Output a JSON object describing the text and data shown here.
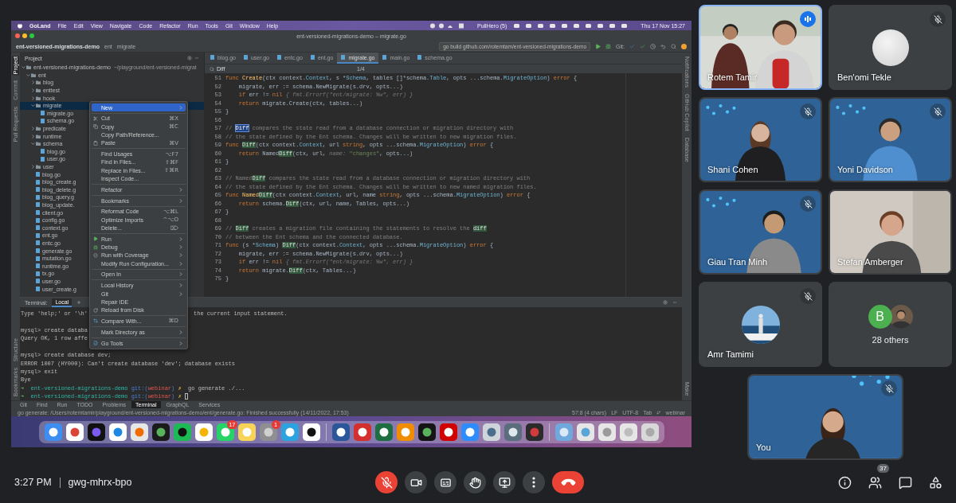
{
  "shared_screen": {
    "menu_bar": {
      "app": "GoLand",
      "items": [
        "File",
        "Edit",
        "View",
        "Navigate",
        "Code",
        "Refactor",
        "Run",
        "Tools",
        "Git",
        "Window",
        "Help"
      ],
      "status_item": "PullHero (5)",
      "clock": "Thu 17 Nov 15:27"
    },
    "window_title": "ent-versioned-migrations-demo – migrate.go",
    "breadcrumbs": [
      "ent-versioned-migrations-demo",
      "ent",
      "migrate"
    ],
    "run_configuration": "go build github.com/rotemtam/ent-versioned-migrations-demo",
    "vcs_label": "Git:",
    "left_tool_windows": [
      {
        "label": "Project",
        "selected": true
      },
      {
        "label": "Commit",
        "selected": false
      },
      {
        "label": "Pull Requests",
        "selected": false
      }
    ],
    "left_bottom_tool_windows": [
      {
        "label": "Structure",
        "selected": false
      },
      {
        "label": "Bookmarks",
        "selected": false
      }
    ],
    "right_tool_windows": [
      "Notifications",
      "GitHub Copilot",
      "Database"
    ],
    "right_bottom_tool_window": "Make",
    "project": {
      "title": "Project",
      "tree": [
        {
          "label": "ent-versioned-migrations-demo",
          "path": "~/playground/ent-versioned-migrat",
          "kind": "folder",
          "expanded": true,
          "selected": false,
          "children": [
            {
              "label": "ent",
              "kind": "folder",
              "expanded": true,
              "selected": false,
              "children": [
                {
                  "label": "blog",
                  "kind": "folder",
                  "expanded": false,
                  "selected": false
                },
                {
                  "label": "enttest",
                  "kind": "folder",
                  "expanded": false,
                  "selected": false
                },
                {
                  "label": "hook",
                  "kind": "folder",
                  "expanded": false,
                  "selected": false
                },
                {
                  "label": "migrate",
                  "kind": "folder",
                  "expanded": true,
                  "selected": true,
                  "children": [
                    {
                      "label": "migrate.go",
                      "kind": "file",
                      "selected": false
                    },
                    {
                      "label": "schema.go",
                      "kind": "file",
                      "selected": false
                    }
                  ]
                },
                {
                  "label": "predicate",
                  "kind": "folder",
                  "expanded": false,
                  "selected": false
                },
                {
                  "label": "runtime",
                  "kind": "folder",
                  "expanded": false,
                  "selected": false
                },
                {
                  "label": "schema",
                  "kind": "folder",
                  "expanded": true,
                  "selected": false,
                  "children": [
                    {
                      "label": "blog.go",
                      "kind": "file",
                      "selected": false
                    },
                    {
                      "label": "user.go",
                      "kind": "file",
                      "selected": false
                    }
                  ]
                },
                {
                  "label": "user",
                  "kind": "folder",
                  "expanded": false,
                  "selected": false
                },
                {
                  "label": "blog.go",
                  "kind": "file",
                  "selected": false
                },
                {
                  "label": "blog_create.g",
                  "kind": "file",
                  "selected": false
                },
                {
                  "label": "blog_delete.g",
                  "kind": "file",
                  "selected": false
                },
                {
                  "label": "blog_query.g",
                  "kind": "file",
                  "selected": false
                },
                {
                  "label": "blog_update.",
                  "kind": "file",
                  "selected": false
                },
                {
                  "label": "client.go",
                  "kind": "file",
                  "selected": false
                },
                {
                  "label": "config.go",
                  "kind": "file",
                  "selected": false
                },
                {
                  "label": "context.go",
                  "kind": "file",
                  "selected": false
                },
                {
                  "label": "ent.go",
                  "kind": "file",
                  "selected": false
                },
                {
                  "label": "entc.go",
                  "kind": "file",
                  "selected": false
                },
                {
                  "label": "generate.go",
                  "kind": "file",
                  "selected": false
                },
                {
                  "label": "mutation.go",
                  "kind": "file",
                  "selected": false
                },
                {
                  "label": "runtime.go",
                  "kind": "file",
                  "selected": false
                },
                {
                  "label": "tx.go",
                  "kind": "file",
                  "selected": false
                },
                {
                  "label": "user.go",
                  "kind": "file",
                  "selected": false
                },
                {
                  "label": "user_create.g",
                  "kind": "file",
                  "selected": false
                }
              ]
            }
          ]
        }
      ]
    },
    "editor": {
      "tabs": [
        {
          "label": "blog.go",
          "selected": false
        },
        {
          "label": "user.go",
          "selected": false
        },
        {
          "label": "entc.go",
          "selected": false
        },
        {
          "label": "ent.go",
          "selected": false
        },
        {
          "label": "migrate.go",
          "selected": true
        },
        {
          "label": "main.go",
          "selected": false
        },
        {
          "label": "schema.go",
          "selected": false
        }
      ],
      "find": {
        "value": "Diff",
        "count": "1/4"
      },
      "lines": [
        {
          "number": "51",
          "segments": [
            {
              "kind": "keyword",
              "text": "func "
            },
            {
              "kind": "function",
              "text": "Create"
            },
            {
              "kind": "plain",
              "text": "(ctx context."
            },
            {
              "kind": "type",
              "text": "Context"
            },
            {
              "kind": "plain",
              "text": ", s *"
            },
            {
              "kind": "type",
              "text": "Schema"
            },
            {
              "kind": "plain",
              "text": ", tables []*schema."
            },
            {
              "kind": "type",
              "text": "Table"
            },
            {
              "kind": "plain",
              "text": ", opts ...schema."
            },
            {
              "kind": "type",
              "text": "MigrateOption"
            },
            {
              "kind": "plain",
              "text": ") "
            },
            {
              "kind": "keyword",
              "text": "error"
            },
            {
              "kind": "plain",
              "text": " {"
            }
          ]
        },
        {
          "number": "52",
          "segments": [
            {
              "kind": "plain",
              "text": "    migrate, err := schema.NewMigrate(s.drv, opts...)"
            }
          ]
        },
        {
          "number": "53",
          "segments": [
            {
              "kind": "keyword",
              "text": "    if"
            },
            {
              "kind": "plain",
              "text": " err != "
            },
            {
              "kind": "keyword",
              "text": "nil"
            },
            {
              "kind": "hint",
              "text": " { fmt.Errorf(\"ent/migrate: %w\", err) }"
            }
          ]
        },
        {
          "number": "54",
          "segments": [
            {
              "kind": "keyword",
              "text": "    return"
            },
            {
              "kind": "plain",
              "text": " migrate.Create(ctx, tables...)"
            }
          ]
        },
        {
          "number": "55",
          "segments": [
            {
              "kind": "plain",
              "text": "}"
            }
          ]
        },
        {
          "number": "56"
        },
        {
          "number": "57",
          "segments": [
            {
              "kind": "comment",
              "text": "// "
            },
            {
              "kind": "current",
              "text": "Diff"
            },
            {
              "kind": "comment",
              "text": " compares the state read from a database connection or migration directory with"
            }
          ]
        },
        {
          "number": "58",
          "segments": [
            {
              "kind": "comment",
              "text": "// the state defined by the Ent schema. Changes will be written to new migration files."
            }
          ]
        },
        {
          "number": "59",
          "segments": [
            {
              "kind": "keyword",
              "text": "func "
            },
            {
              "kind": "match",
              "text": "Diff"
            },
            {
              "kind": "plain",
              "text": "(ctx context."
            },
            {
              "kind": "type",
              "text": "Context"
            },
            {
              "kind": "plain",
              "text": ", url "
            },
            {
              "kind": "keyword",
              "text": "string"
            },
            {
              "kind": "plain",
              "text": ", opts ...schema."
            },
            {
              "kind": "type",
              "text": "MigrateOption"
            },
            {
              "kind": "plain",
              "text": ") "
            },
            {
              "kind": "keyword",
              "text": "error"
            },
            {
              "kind": "plain",
              "text": " {"
            }
          ]
        },
        {
          "number": "60",
          "segments": [
            {
              "kind": "keyword",
              "text": "    return"
            },
            {
              "kind": "plain",
              "text": " Named"
            },
            {
              "kind": "match",
              "text": "Diff"
            },
            {
              "kind": "plain",
              "text": "(ctx, url, "
            },
            {
              "kind": "hint",
              "text": "name: "
            },
            {
              "kind": "string",
              "text": "\"changes\""
            },
            {
              "kind": "plain",
              "text": ", opts...)"
            }
          ]
        },
        {
          "number": "61",
          "segments": [
            {
              "kind": "plain",
              "text": "}"
            }
          ]
        },
        {
          "number": "62"
        },
        {
          "number": "63",
          "segments": [
            {
              "kind": "comment",
              "text": "// Named"
            },
            {
              "kind": "match",
              "text": "Diff"
            },
            {
              "kind": "comment",
              "text": " compares the state read from a database connection or migration directory with"
            }
          ]
        },
        {
          "number": "64",
          "segments": [
            {
              "kind": "comment",
              "text": "// the state defined by the Ent schema. Changes will be written to new named migration files."
            }
          ]
        },
        {
          "number": "65",
          "segments": [
            {
              "kind": "keyword",
              "text": "func "
            },
            {
              "kind": "function",
              "text": "Named"
            },
            {
              "kind": "match",
              "text": "Diff"
            },
            {
              "kind": "plain",
              "text": "(ctx context."
            },
            {
              "kind": "type",
              "text": "Context"
            },
            {
              "kind": "plain",
              "text": ", url, name "
            },
            {
              "kind": "keyword",
              "text": "string"
            },
            {
              "kind": "plain",
              "text": ", opts ...schema."
            },
            {
              "kind": "type",
              "text": "MigrateOption"
            },
            {
              "kind": "plain",
              "text": ") "
            },
            {
              "kind": "keyword",
              "text": "error"
            },
            {
              "kind": "plain",
              "text": " {"
            }
          ]
        },
        {
          "number": "66",
          "segments": [
            {
              "kind": "keyword",
              "text": "    return"
            },
            {
              "kind": "plain",
              "text": " schema."
            },
            {
              "kind": "match",
              "text": "Diff"
            },
            {
              "kind": "plain",
              "text": "(ctx, url, name, Tables, opts...)"
            }
          ]
        },
        {
          "number": "67",
          "segments": [
            {
              "kind": "plain",
              "text": "}"
            }
          ]
        },
        {
          "number": "68"
        },
        {
          "number": "69",
          "segments": [
            {
              "kind": "comment",
              "text": "// "
            },
            {
              "kind": "match",
              "text": "Diff"
            },
            {
              "kind": "comment",
              "text": " creates a migration file containing the statements to resolve the "
            },
            {
              "kind": "match",
              "text": "diff"
            }
          ]
        },
        {
          "number": "70",
          "segments": [
            {
              "kind": "comment",
              "text": "// between the Ent schema and the connected database."
            }
          ]
        },
        {
          "number": "71",
          "segments": [
            {
              "kind": "keyword",
              "text": "func "
            },
            {
              "kind": "plain",
              "text": "(s *"
            },
            {
              "kind": "type",
              "text": "Schema"
            },
            {
              "kind": "plain",
              "text": ") "
            },
            {
              "kind": "match",
              "text": "Diff"
            },
            {
              "kind": "plain",
              "text": "(ctx context."
            },
            {
              "kind": "type",
              "text": "Context"
            },
            {
              "kind": "plain",
              "text": ", opts ...schema."
            },
            {
              "kind": "type",
              "text": "MigrateOption"
            },
            {
              "kind": "plain",
              "text": ") "
            },
            {
              "kind": "keyword",
              "text": "error"
            },
            {
              "kind": "plain",
              "text": " {"
            }
          ]
        },
        {
          "number": "72",
          "segments": [
            {
              "kind": "plain",
              "text": "    migrate, err := schema.NewMigrate(s.drv, opts...)"
            }
          ]
        },
        {
          "number": "73",
          "segments": [
            {
              "kind": "keyword",
              "text": "    if"
            },
            {
              "kind": "plain",
              "text": " err != "
            },
            {
              "kind": "keyword",
              "text": "nil"
            },
            {
              "kind": "hint",
              "text": " { fmt.Errorf(\"ent/migrate: %w\", err) }"
            }
          ]
        },
        {
          "number": "74",
          "segments": [
            {
              "kind": "keyword",
              "text": "    return"
            },
            {
              "kind": "plain",
              "text": " migrate."
            },
            {
              "kind": "match",
              "text": "Diff"
            },
            {
              "kind": "plain",
              "text": "(ctx, Tables...)"
            }
          ]
        },
        {
          "number": "75",
          "segments": [
            {
              "kind": "plain",
              "text": "}"
            }
          ]
        }
      ]
    },
    "context_menu": {
      "items": [
        {
          "kind": "item",
          "label": "New",
          "selected": true,
          "submenu": true
        },
        {
          "kind": "separator"
        },
        {
          "kind": "item",
          "label": "Cut",
          "shortcut": "⌘X",
          "selected": false
        },
        {
          "kind": "item",
          "label": "Copy",
          "shortcut": "⌘C",
          "selected": false
        },
        {
          "kind": "item",
          "label": "Copy Path/Reference...",
          "selected": false
        },
        {
          "kind": "item",
          "label": "Paste",
          "shortcut": "⌘V",
          "selected": false
        },
        {
          "kind": "separator"
        },
        {
          "kind": "item",
          "label": "Find Usages",
          "shortcut": "⌥F7",
          "selected": false
        },
        {
          "kind": "item",
          "label": "Find in Files...",
          "shortcut": "⇧⌘F",
          "selected": false
        },
        {
          "kind": "item",
          "label": "Replace in Files...",
          "shortcut": "⇧⌘R",
          "selected": false
        },
        {
          "kind": "item",
          "label": "Inspect Code...",
          "selected": false
        },
        {
          "kind": "separator"
        },
        {
          "kind": "item",
          "label": "Refactor",
          "selected": false,
          "submenu": true
        },
        {
          "kind": "separator"
        },
        {
          "kind": "item",
          "label": "Bookmarks",
          "selected": false,
          "submenu": true
        },
        {
          "kind": "separator"
        },
        {
          "kind": "item",
          "label": "Reformat Code",
          "shortcut": "⌥⌘L",
          "selected": false
        },
        {
          "kind": "item",
          "label": "Optimize Imports",
          "shortcut": "^⌥O",
          "selected": false
        },
        {
          "kind": "item",
          "label": "Delete...",
          "shortcut": "⌦",
          "selected": false
        },
        {
          "kind": "separator"
        },
        {
          "kind": "item",
          "label": "Run",
          "selected": false,
          "submenu": true
        },
        {
          "kind": "item",
          "label": "Debug",
          "selected": false,
          "submenu": true
        },
        {
          "kind": "item",
          "label": "Run with Coverage",
          "selected": false,
          "submenu": true
        },
        {
          "kind": "item",
          "label": "Modify Run Configuration...",
          "selected": false,
          "submenu": true
        },
        {
          "kind": "separator"
        },
        {
          "kind": "item",
          "label": "Open In",
          "selected": false,
          "submenu": true
        },
        {
          "kind": "separator"
        },
        {
          "kind": "item",
          "label": "Local History",
          "selected": false,
          "submenu": true
        },
        {
          "kind": "item",
          "label": "Git",
          "selected": false,
          "submenu": true
        },
        {
          "kind": "item",
          "label": "Repair IDE",
          "selected": false
        },
        {
          "kind": "item",
          "label": "Reload from Disk",
          "selected": false
        },
        {
          "kind": "separator"
        },
        {
          "kind": "item",
          "label": "Compare With...",
          "shortcut": "⌘D",
          "selected": false
        },
        {
          "kind": "separator"
        },
        {
          "kind": "item",
          "label": "Mark Directory as",
          "selected": false,
          "submenu": true
        },
        {
          "kind": "separator"
        },
        {
          "kind": "item",
          "label": "Go Tools",
          "selected": false,
          "submenu": true
        }
      ]
    },
    "terminal": {
      "title": "Terminal:",
      "tabs": [
        {
          "label": "Local",
          "selected": true
        }
      ],
      "lines": [
        {
          "kind": "output",
          "segments": [
            {
              "kind": "plain",
              "text": "Type 'help;' or '\\h'"
            }
          ],
          "tail": "the current input statement."
        },
        {
          "kind": "blank"
        },
        {
          "kind": "output",
          "segments": [
            {
              "kind": "plain",
              "text": "mysql> create databa"
            }
          ]
        },
        {
          "kind": "output",
          "segments": [
            {
              "kind": "plain",
              "text": "Query OK, 1 row affe"
            }
          ]
        },
        {
          "kind": "blank"
        },
        {
          "kind": "output",
          "segments": [
            {
              "kind": "plain",
              "text": "mysql> create database dev;"
            }
          ]
        },
        {
          "kind": "output",
          "segments": [
            {
              "kind": "plain",
              "text": "ERROR 1007 (HY000): Can't create database 'dev'; database exists"
            }
          ]
        },
        {
          "kind": "output",
          "segments": [
            {
              "kind": "plain",
              "text": "mysql> exit"
            }
          ]
        },
        {
          "kind": "output",
          "segments": [
            {
              "kind": "plain",
              "text": "Bye"
            }
          ]
        },
        {
          "kind": "output",
          "segments": [
            {
              "kind": "arrow",
              "text": "➜"
            },
            {
              "kind": "project",
              "text": "  ent-versioned-migrations-demo "
            },
            {
              "kind": "git",
              "text": "git:("
            },
            {
              "kind": "branch",
              "text": "webinar"
            },
            {
              "kind": "git",
              "text": ")"
            },
            {
              "kind": "dirty",
              "text": " ✗"
            },
            {
              "kind": "plain",
              "text": "  go generate ./..."
            }
          ]
        },
        {
          "kind": "prompt",
          "segments": [
            {
              "kind": "arrow",
              "text": "➜"
            },
            {
              "kind": "project",
              "text": "  ent-versioned-migrations-demo "
            },
            {
              "kind": "git",
              "text": "git:("
            },
            {
              "kind": "branch",
              "text": "webinar"
            },
            {
              "kind": "git",
              "text": ")"
            },
            {
              "kind": "dirty",
              "text": " ✗"
            }
          ]
        }
      ]
    },
    "tool_tabs": [
      {
        "label": "Git",
        "selected": false
      },
      {
        "label": "Find",
        "selected": false
      },
      {
        "label": "Run",
        "selected": false
      },
      {
        "label": "TODO",
        "selected": false
      },
      {
        "label": "Problems",
        "selected": false
      },
      {
        "label": "Terminal",
        "selected": true
      },
      {
        "label": "GraphQL",
        "selected": false
      },
      {
        "label": "Services",
        "selected": false
      }
    ],
    "status": {
      "message": "go generate: /Users/rotemtamir/playground/ent-versioned-migrations-demo/ent/generate.go: Finished successfully (14/11/2022, 17:53)",
      "position": "57:8 (4 chars)",
      "line_ending": "LF",
      "encoding": "UTF-8",
      "indent": "Tab",
      "branch": "webinar"
    },
    "dock": {
      "badges": [
        "17",
        "1"
      ]
    }
  },
  "participants": [
    {
      "name": "Rotem Tamir",
      "kind": "video",
      "muted": false,
      "speaking": true
    },
    {
      "name": "Ben'omi Tekle",
      "kind": "blank-avatar",
      "muted": true,
      "speaking": false
    },
    {
      "name": "Shani Cohen",
      "kind": "video",
      "muted": true,
      "speaking": false
    },
    {
      "name": "Yoni Davidson",
      "kind": "video",
      "muted": true,
      "speaking": false
    },
    {
      "name": "Giau Tran Minh",
      "kind": "video",
      "muted": true,
      "speaking": false
    },
    {
      "name": "Stefan Amberger",
      "kind": "video",
      "muted": false,
      "speaking": false
    },
    {
      "name": "Amr Tamimi",
      "kind": "photo-avatar",
      "muted": true,
      "speaking": false
    },
    {
      "name": "28 others",
      "kind": "others",
      "initial": "B"
    }
  ],
  "self": {
    "name": "You",
    "muted": true
  },
  "meeting": {
    "time": "3:27 PM",
    "code": "gwg-mhrx-bpo"
  },
  "call_controls": [
    {
      "kind": "microphone",
      "on": false
    },
    {
      "kind": "camera",
      "on": true
    },
    {
      "kind": "captions",
      "on": false
    },
    {
      "kind": "raise-hand"
    },
    {
      "kind": "present"
    },
    {
      "kind": "more"
    },
    {
      "kind": "leave"
    }
  ],
  "side_controls": [
    {
      "kind": "info"
    },
    {
      "kind": "people",
      "badge": "37"
    },
    {
      "kind": "chat"
    },
    {
      "kind": "activities"
    }
  ]
}
